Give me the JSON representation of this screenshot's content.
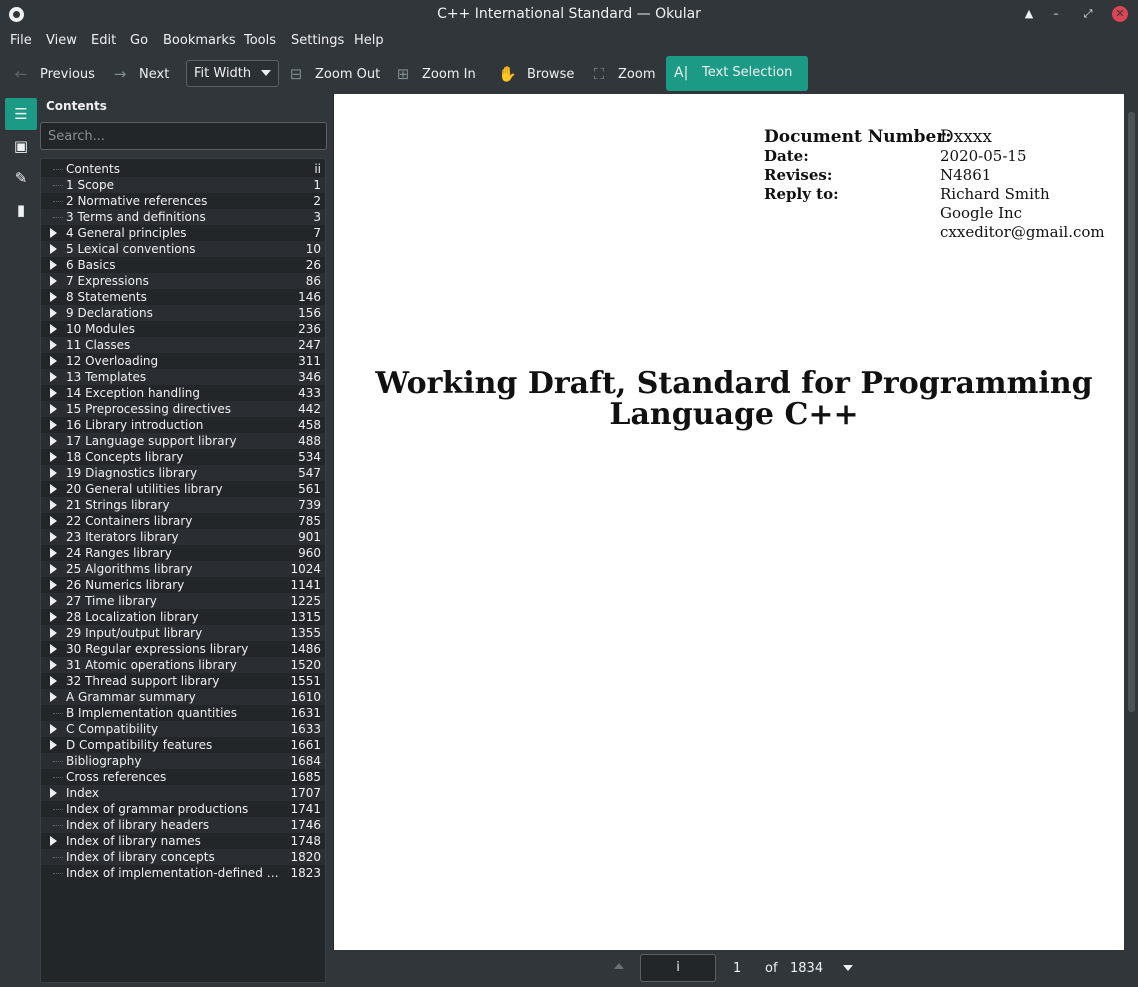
{
  "window": {
    "title": "C++ International Standard — Okular"
  },
  "menu": [
    "File",
    "View",
    "Edit",
    "Go",
    "Bookmarks",
    "Tools",
    "Settings",
    "Help"
  ],
  "toolbar": {
    "previous": "Previous",
    "next": "Next",
    "zoom_mode": "Fit Width",
    "zoom_out": "Zoom Out",
    "zoom_in": "Zoom In",
    "browse": "Browse",
    "zoom": "Zoom",
    "text_selection": "Text Selection"
  },
  "sidebar": {
    "title": "Contents",
    "search_placeholder": "Search...",
    "toc": [
      {
        "label": "Contents",
        "page": "ii",
        "expandable": false
      },
      {
        "label": "1 Scope",
        "page": "1",
        "expandable": false
      },
      {
        "label": "2 Normative references",
        "page": "2",
        "expandable": false
      },
      {
        "label": "3 Terms and definitions",
        "page": "3",
        "expandable": false
      },
      {
        "label": "4 General principles",
        "page": "7",
        "expandable": true
      },
      {
        "label": "5 Lexical conventions",
        "page": "10",
        "expandable": true
      },
      {
        "label": "6 Basics",
        "page": "26",
        "expandable": true
      },
      {
        "label": "7 Expressions",
        "page": "86",
        "expandable": true
      },
      {
        "label": "8 Statements",
        "page": "146",
        "expandable": true
      },
      {
        "label": "9 Declarations",
        "page": "156",
        "expandable": true
      },
      {
        "label": "10 Modules",
        "page": "236",
        "expandable": true
      },
      {
        "label": "11 Classes",
        "page": "247",
        "expandable": true
      },
      {
        "label": "12 Overloading",
        "page": "311",
        "expandable": true
      },
      {
        "label": "13 Templates",
        "page": "346",
        "expandable": true
      },
      {
        "label": "14 Exception handling",
        "page": "433",
        "expandable": true
      },
      {
        "label": "15 Preprocessing directives",
        "page": "442",
        "expandable": true
      },
      {
        "label": "16 Library introduction",
        "page": "458",
        "expandable": true
      },
      {
        "label": "17 Language support library",
        "page": "488",
        "expandable": true
      },
      {
        "label": "18 Concepts library",
        "page": "534",
        "expandable": true
      },
      {
        "label": "19 Diagnostics library",
        "page": "547",
        "expandable": true
      },
      {
        "label": "20 General utilities library",
        "page": "561",
        "expandable": true
      },
      {
        "label": "21 Strings library",
        "page": "739",
        "expandable": true
      },
      {
        "label": "22 Containers library",
        "page": "785",
        "expandable": true
      },
      {
        "label": "23 Iterators library",
        "page": "901",
        "expandable": true
      },
      {
        "label": "24 Ranges library",
        "page": "960",
        "expandable": true
      },
      {
        "label": "25 Algorithms library",
        "page": "1024",
        "expandable": true
      },
      {
        "label": "26 Numerics library",
        "page": "1141",
        "expandable": true
      },
      {
        "label": "27 Time library",
        "page": "1225",
        "expandable": true
      },
      {
        "label": "28 Localization library",
        "page": "1315",
        "expandable": true
      },
      {
        "label": "29 Input/output library",
        "page": "1355",
        "expandable": true
      },
      {
        "label": "30 Regular expressions library",
        "page": "1486",
        "expandable": true
      },
      {
        "label": "31 Atomic operations library",
        "page": "1520",
        "expandable": true
      },
      {
        "label": "32 Thread support library",
        "page": "1551",
        "expandable": true
      },
      {
        "label": "A Grammar summary",
        "page": "1610",
        "expandable": true
      },
      {
        "label": "B Implementation quantities",
        "page": "1631",
        "expandable": false
      },
      {
        "label": "C Compatibility",
        "page": "1633",
        "expandable": true
      },
      {
        "label": "D Compatibility features",
        "page": "1661",
        "expandable": true
      },
      {
        "label": "Bibliography",
        "page": "1684",
        "expandable": false
      },
      {
        "label": "Cross references",
        "page": "1685",
        "expandable": false
      },
      {
        "label": "Index",
        "page": "1707",
        "expandable": true
      },
      {
        "label": "Index of grammar productions",
        "page": "1741",
        "expandable": false
      },
      {
        "label": "Index of library headers",
        "page": "1746",
        "expandable": false
      },
      {
        "label": "Index of library names",
        "page": "1748",
        "expandable": true
      },
      {
        "label": "Index of library concepts",
        "page": "1820",
        "expandable": false
      },
      {
        "label": "Index of implementation-defined b…",
        "page": "1823",
        "expandable": false
      }
    ]
  },
  "document": {
    "header": [
      {
        "key": "Document Number:",
        "value": "Dxxxx"
      },
      {
        "key": "Date:",
        "value": "2020-05-15"
      },
      {
        "key": "Revises:",
        "value": "N4861"
      },
      {
        "key": "Reply to:",
        "value": "Richard Smith"
      },
      {
        "key": "",
        "value": "Google Inc"
      },
      {
        "key": "",
        "value": "cxxeditor@gmail.com"
      }
    ],
    "title": "Working Draft, Standard for Programming Language C++"
  },
  "pagebar": {
    "page_label": "i",
    "page_number": "1",
    "of": "of",
    "total": "1834"
  }
}
